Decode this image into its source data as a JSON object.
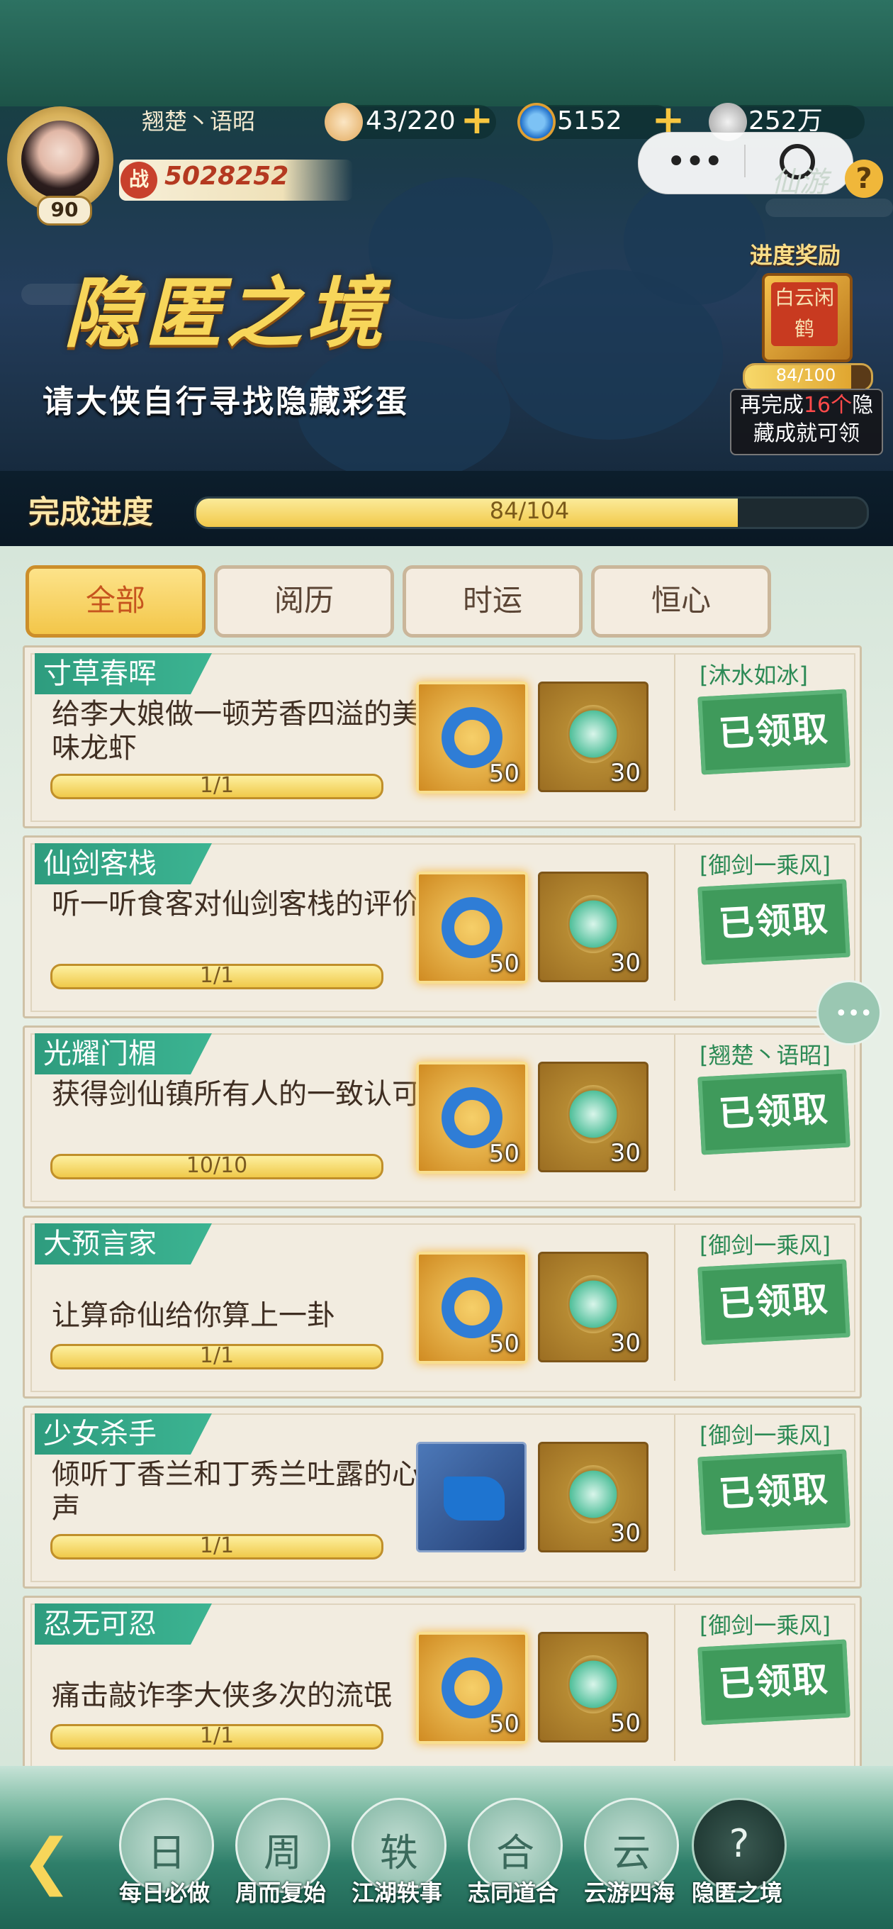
{
  "player": {
    "name": "翘楚丶语昭",
    "level": "90",
    "power_label": "战",
    "power": "5028252"
  },
  "resources": {
    "stamina": "43/220",
    "jade": "5152",
    "coins": "252万"
  },
  "miniprogram_logo": "仙游",
  "event": {
    "title": "隐匿之境",
    "subtitle": "请大侠自行寻找隐藏彩蛋",
    "reward_label": "进度奖励",
    "reward_seal": "白云闲鹤",
    "reward_count": "84/100",
    "reward_progress": 0.84,
    "reward_tip": "再完成16个隐藏成就可领",
    "reward_tip_highlight": "16个",
    "progress_label": "完成进度",
    "progress_text": "84/104",
    "progress": 0.808
  },
  "tabs": [
    {
      "label": "全部",
      "active": true
    },
    {
      "label": "阅历",
      "active": false
    },
    {
      "label": "时运",
      "active": false
    },
    {
      "label": "恒心",
      "active": false
    }
  ],
  "tasks": [
    {
      "title": "寸草春晖",
      "desc": "给李大娘做一顿芳香四溢的美味龙虾",
      "progress": "1/1",
      "reward1_icon": "jade-ring-icon",
      "reward1_qty": "50",
      "reward2_icon": "leaf-medal-icon",
      "reward2_qty": "30",
      "source": "[沐水如冰]",
      "status": "已领取"
    },
    {
      "title": "仙剑客栈",
      "desc": "听一听食客对仙剑客栈的评价",
      "progress": "1/1",
      "reward1_icon": "jade-ring-icon",
      "reward1_qty": "50",
      "reward2_icon": "leaf-medal-icon",
      "reward2_qty": "30",
      "source": "[御剑一乘风]",
      "status": "已领取"
    },
    {
      "title": "光耀门楣",
      "desc": "获得剑仙镇所有人的一致认可",
      "progress": "10/10",
      "reward1_icon": "jade-ring-icon",
      "reward1_qty": "50",
      "reward2_icon": "leaf-medal-icon",
      "reward2_qty": "30",
      "source": "[翘楚丶语昭]",
      "status": "已领取"
    },
    {
      "title": "大预言家",
      "desc": "让算命仙给你算上一卦",
      "progress": "1/1",
      "reward1_icon": "jade-ring-icon",
      "reward1_qty": "50",
      "reward2_icon": "leaf-medal-icon",
      "reward2_qty": "30",
      "source": "[御剑一乘风]",
      "status": "已领取"
    },
    {
      "title": "少女杀手",
      "desc": "倾听丁香兰和丁秀兰吐露的心声",
      "progress": "1/1",
      "reward1_icon": "blue-boots-icon",
      "reward1_qty": "",
      "reward2_icon": "leaf-medal-icon",
      "reward2_qty": "30",
      "source": "[御剑一乘风]",
      "status": "已领取"
    },
    {
      "title": "忍无可忍",
      "desc": "痛击敲诈李大侠多次的流氓",
      "progress": "1/1",
      "reward1_icon": "jade-ring-icon",
      "reward1_qty": "50",
      "reward2_icon": "leaf-medal-icon",
      "reward2_qty": "50",
      "source": "[御剑一乘风]",
      "status": "已领取"
    }
  ],
  "nav": [
    {
      "label": "每日必做",
      "glyph": "日",
      "active": false
    },
    {
      "label": "周而复始",
      "glyph": "周",
      "active": false
    },
    {
      "label": "江湖轶事",
      "glyph": "轶",
      "active": false
    },
    {
      "label": "志同道合",
      "glyph": "合",
      "active": false
    },
    {
      "label": "云游四海",
      "glyph": "云",
      "active": false
    },
    {
      "label": "隐匿之境",
      "glyph": "?",
      "active": true
    }
  ],
  "colors": {
    "accent_gold": "#f7d65a",
    "ribbon_teal": "#2e9c7e",
    "claimed_green": "#3f9a5b",
    "highlight_red": "#ff4a4a"
  }
}
